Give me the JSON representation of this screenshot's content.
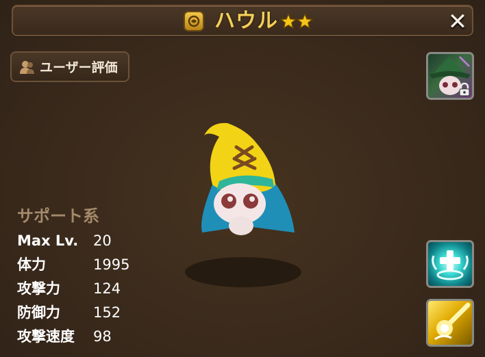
{
  "header": {
    "monster_name": "ハウル",
    "star_count": 2,
    "close_label": "✕"
  },
  "review_button": {
    "label": "ユーザー評価"
  },
  "stats": {
    "category": "サポート系",
    "rows": [
      {
        "label": "Max Lv.",
        "value": "20"
      },
      {
        "label": "体力",
        "value": "1995"
      },
      {
        "label": "攻撃力",
        "value": "124"
      },
      {
        "label": "防御力",
        "value": "152"
      },
      {
        "label": "攻撃速度",
        "value": "98"
      }
    ]
  },
  "icons": {
    "title": "monster-book-icon",
    "review": "users-icon",
    "portrait": "awakened-portrait-locked",
    "skill1": "heal-skill-icon",
    "skill2": "attack-skill-icon"
  },
  "colors": {
    "title_text": "#f2cf5a",
    "category_text": "#a48a6b",
    "star": "#f5c518",
    "background": "#3a2a1c"
  }
}
